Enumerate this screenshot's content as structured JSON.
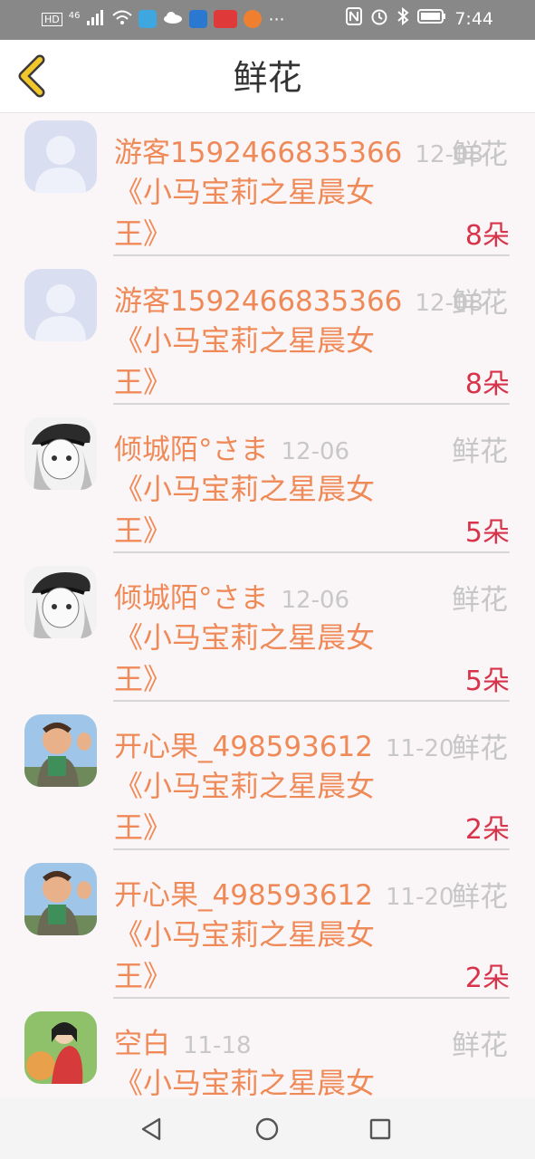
{
  "status_bar": {
    "left": [
      "HD",
      "46"
    ],
    "time": "7:44",
    "icons": [
      "signal-icon",
      "wifi-icon",
      "app-icon",
      "cloud-icon",
      "send-icon",
      "news-app-icon",
      "play-icon",
      "more-icon",
      "nfc-icon",
      "alarm-icon",
      "bluetooth-icon",
      "battery-icon"
    ]
  },
  "header": {
    "title": "鲜花",
    "back_icon": "chevron-left-icon"
  },
  "list": {
    "items": [
      {
        "user": "游客1592466835366",
        "date": "12-08",
        "type": "鲜花",
        "book": "《小马宝莉之星晨女王》",
        "count": "8朵",
        "avatar": "default"
      },
      {
        "user": "游客1592466835366",
        "date": "12-08",
        "type": "鲜花",
        "book": "《小马宝莉之星晨女王》",
        "count": "8朵",
        "avatar": "default"
      },
      {
        "user": "倾城陌°さま",
        "date": "12-06",
        "type": "鲜花",
        "book": "《小马宝莉之星晨女王》",
        "count": "5朵",
        "avatar": "anime"
      },
      {
        "user": "倾城陌°さま",
        "date": "12-06",
        "type": "鲜花",
        "book": "《小马宝莉之星晨女王》",
        "count": "5朵",
        "avatar": "anime"
      },
      {
        "user": "开心果_498593612",
        "date": "11-20",
        "type": "鲜花",
        "book": "《小马宝莉之星晨女王》",
        "count": "2朵",
        "avatar": "kid"
      },
      {
        "user": "开心果_498593612",
        "date": "11-20",
        "type": "鲜花",
        "book": "《小马宝莉之星晨女王》",
        "count": "2朵",
        "avatar": "kid"
      },
      {
        "user": "空白",
        "date": "11-18",
        "type": "鲜花",
        "book": "《小马宝莉之星晨女王》",
        "count": "",
        "avatar": "girl"
      }
    ]
  },
  "nav_bar": {
    "icons": [
      "back-triangle-icon",
      "home-circle-icon",
      "recents-square-icon"
    ]
  },
  "colors": {
    "accent_orange": "#ef8a58",
    "count_red": "#d8334a",
    "back_yellow": "#f3c62b"
  }
}
